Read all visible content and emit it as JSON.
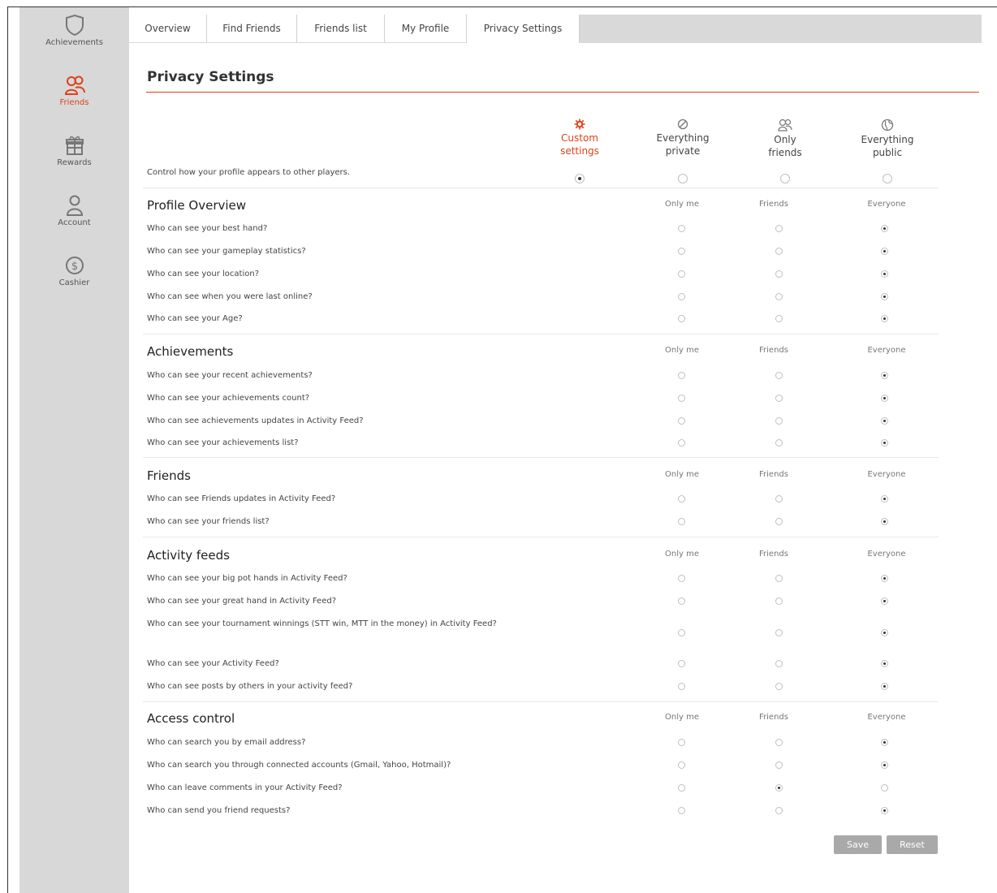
{
  "sidebar": {
    "items": [
      {
        "label": "Achievements",
        "icon": "shield-icon"
      },
      {
        "label": "Friends",
        "icon": "friends-icon",
        "active": true
      },
      {
        "label": "Rewards",
        "icon": "gift-icon"
      },
      {
        "label": "Account",
        "icon": "user-icon"
      },
      {
        "label": "Cashier",
        "icon": "dollar-icon"
      }
    ]
  },
  "tabs": [
    {
      "label": "Overview"
    },
    {
      "label": "Find Friends"
    },
    {
      "label": "Friends list"
    },
    {
      "label": "My Profile"
    },
    {
      "label": "Privacy Settings",
      "active": true
    }
  ],
  "page": {
    "title": "Privacy Settings",
    "intro": "Control how your profile appears to other players.",
    "accent_color": "#e0401a"
  },
  "presets": {
    "selected": "custom",
    "items": [
      {
        "id": "custom",
        "line1": "Custom",
        "line2": "settings",
        "icon": "gear-icon"
      },
      {
        "id": "private",
        "line1": "Everything",
        "line2": "private",
        "icon": "no-entry-icon"
      },
      {
        "id": "friends",
        "line1": "Only",
        "line2": "friends",
        "icon": "friends-icon"
      },
      {
        "id": "public",
        "line1": "Everything",
        "line2": "public",
        "icon": "globe-icon"
      }
    ]
  },
  "columns": [
    "Only me",
    "Friends",
    "Everyone"
  ],
  "sections": [
    {
      "title": "Profile Overview",
      "questions": [
        {
          "text": "Who can see your best hand?",
          "selected": 2
        },
        {
          "text": "Who can see your gameplay statistics?",
          "selected": 2
        },
        {
          "text": "Who can see your location?",
          "selected": 2
        },
        {
          "text": "Who can see when you were last online?",
          "selected": 2
        },
        {
          "text": "Who can see your Age?",
          "selected": 2
        }
      ]
    },
    {
      "title": "Achievements",
      "questions": [
        {
          "text": "Who can see your recent achievements?",
          "selected": 2
        },
        {
          "text": "Who can see your achievements count?",
          "selected": 2
        },
        {
          "text": "Who can see achievements updates in Activity Feed?",
          "selected": 2
        },
        {
          "text": "Who can see your achievements list?",
          "selected": 2
        }
      ]
    },
    {
      "title": "Friends",
      "questions": [
        {
          "text": "Who can see Friends updates in Activity Feed?",
          "selected": 2
        },
        {
          "text": "Who can see your friends list?",
          "selected": 2
        }
      ]
    },
    {
      "title": "Activity feeds",
      "questions": [
        {
          "text": "Who can see your big pot hands in Activity Feed?",
          "selected": 2
        },
        {
          "text": "Who can see your great hand in Activity Feed?",
          "selected": 2
        },
        {
          "text": "Who can see your tournament winnings (STT win, MTT in the money) in Activity Feed?",
          "selected": 2
        },
        {
          "text": "Who can see your Activity Feed?",
          "selected": 2
        },
        {
          "text": "Who can see posts by others in your activity feed?",
          "selected": 2
        }
      ]
    },
    {
      "title": "Access control",
      "questions": [
        {
          "text": "Who can search you by email address?",
          "selected": 2
        },
        {
          "text": "Who can search you through connected accounts (Gmail, Yahoo, Hotmail)?",
          "selected": 2
        },
        {
          "text": "Who can leave comments in your Activity Feed?",
          "selected": 1
        },
        {
          "text": "Who can send you friend requests?",
          "selected": 2
        }
      ]
    }
  ],
  "buttons": {
    "save": "Save",
    "reset": "Reset"
  }
}
